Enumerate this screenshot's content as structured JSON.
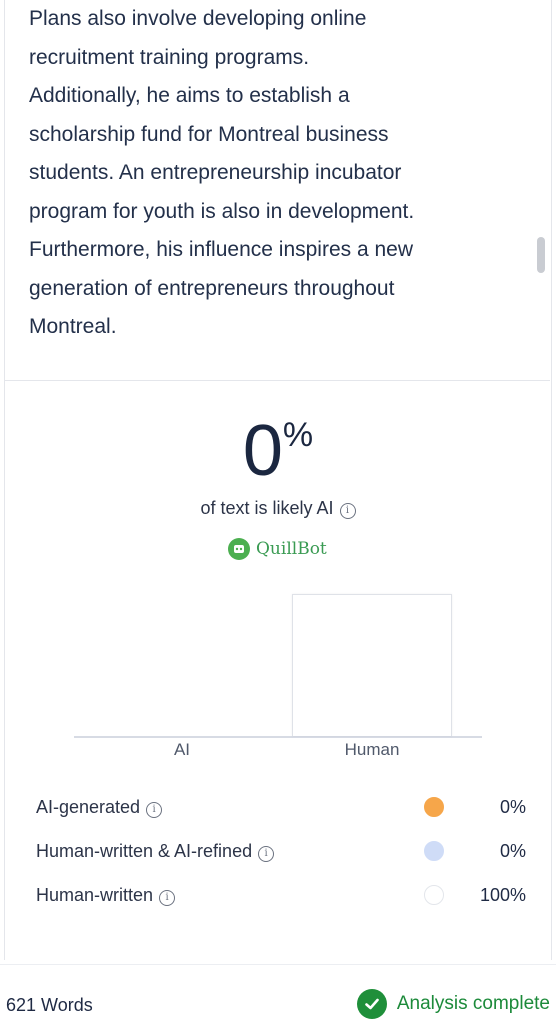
{
  "article": {
    "lines": [
      "Plans also involve developing online",
      "recruitment training programs.",
      "Additionally, he aims to establish a",
      "scholarship fund for Montreal business",
      "students. An entrepreneurship incubator",
      "program for youth is also in development.",
      "Furthermore, his influence inspires a new",
      "generation of entrepreneurs throughout",
      "Montreal."
    ]
  },
  "result": {
    "score": "0",
    "percent_sign": "%",
    "caption": "of text is likely AI",
    "info_glyph": "i"
  },
  "brand": {
    "name": "QuillBot"
  },
  "chart_data": {
    "type": "bar",
    "categories": [
      "AI",
      "Human"
    ],
    "values": [
      0,
      100
    ],
    "ylim": [
      0,
      100
    ],
    "grid": false
  },
  "legend": [
    {
      "label": "AI-generated",
      "value": "0%",
      "color": "#f6a64a",
      "border": "#f6a64a"
    },
    {
      "label": "Human-written & AI-refined",
      "value": "0%",
      "color": "#cfdcf7",
      "border": "#cfdcf7"
    },
    {
      "label": "Human-written",
      "value": "100%",
      "color": "#ffffff",
      "border": "#e3e6eb"
    }
  ],
  "footer": {
    "word_count": "621 Words",
    "status": "Analysis complete"
  },
  "colors": {
    "accent_green": "#1f8f3a",
    "text_dark": "#1f2a44"
  }
}
